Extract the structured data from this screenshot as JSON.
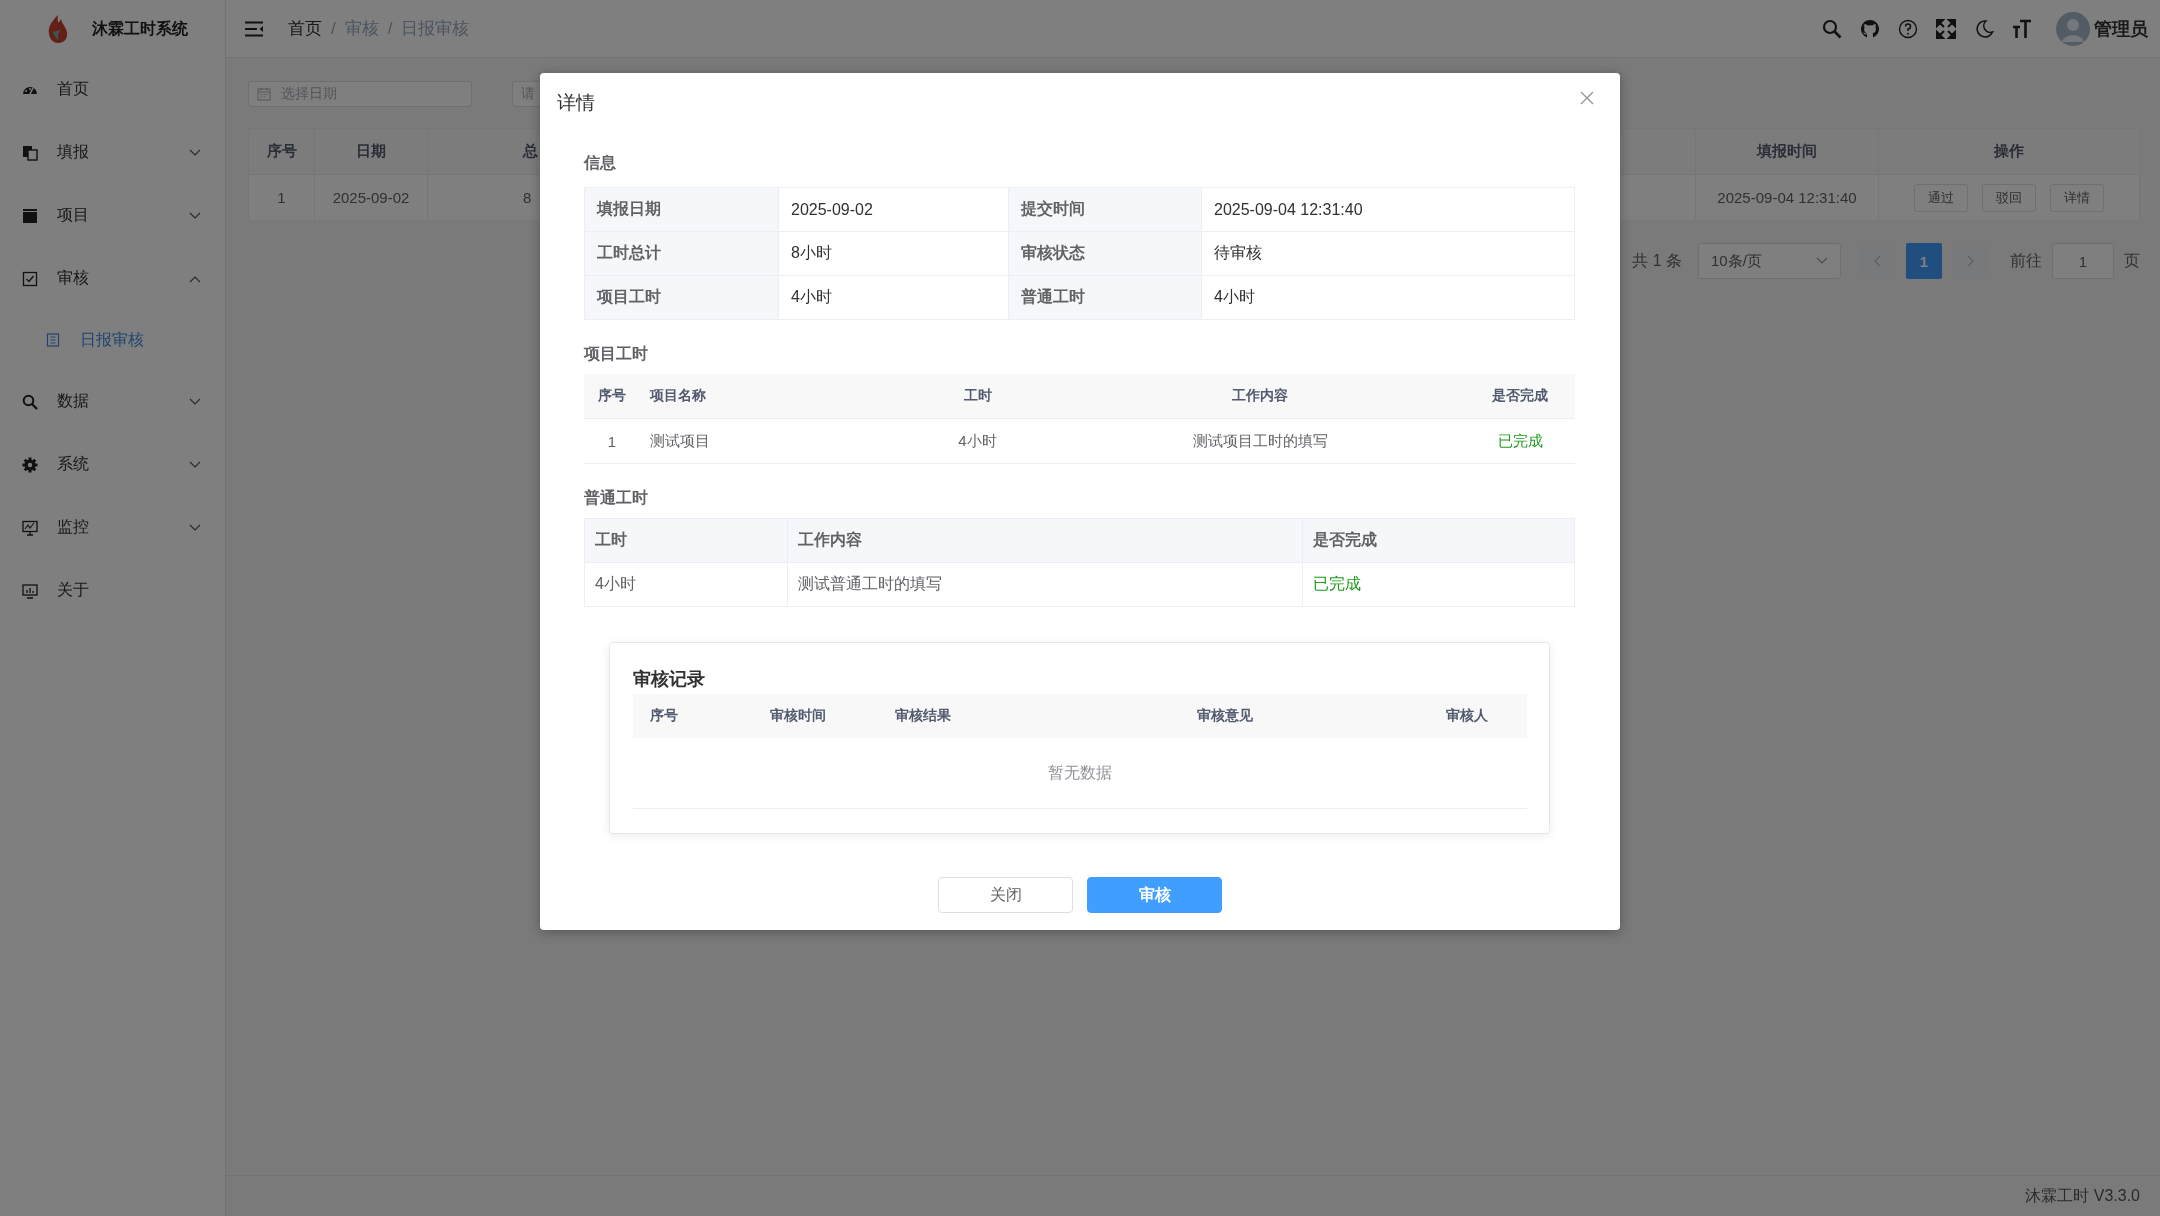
{
  "app": {
    "title": "沐霖工时系统"
  },
  "sidebar": {
    "items": [
      {
        "label": "首页",
        "kind": "link"
      },
      {
        "label": "填报",
        "kind": "group",
        "expanded": false
      },
      {
        "label": "项目",
        "kind": "group",
        "expanded": false
      },
      {
        "label": "审核",
        "kind": "group",
        "expanded": true,
        "children": [
          {
            "label": "日报审核",
            "selected": true
          }
        ]
      },
      {
        "label": "数据",
        "kind": "group",
        "expanded": false
      },
      {
        "label": "系统",
        "kind": "group",
        "expanded": false
      },
      {
        "label": "监控",
        "kind": "group",
        "expanded": false
      },
      {
        "label": "关于",
        "kind": "link"
      }
    ]
  },
  "header": {
    "breadcrumb": [
      {
        "label": "首页",
        "separator": "/"
      },
      {
        "label": "审核",
        "separator": "/"
      },
      {
        "label": "日报审核"
      }
    ],
    "user": {
      "name": "管理员"
    }
  },
  "filters": {
    "date": {
      "placeholder": "选择日期"
    },
    "field_2": {
      "placeholder": "请"
    }
  },
  "table": {
    "columns": [
      "序号",
      "日期",
      "总",
      "填报时间",
      "操作"
    ],
    "rows": [
      {
        "cells": [
          "1",
          "2025-09-02",
          "8",
          "2025-09-04 12:31:40"
        ],
        "actions": [
          "通过",
          "驳回",
          "详情"
        ]
      }
    ]
  },
  "pagination": {
    "total": "共 1 条",
    "page_size": "10条/页",
    "pages": [
      {
        "label": "1",
        "selected": true
      }
    ],
    "jump_label": "前往",
    "jump_value": "1",
    "jump_suffix": "页"
  },
  "footer": {
    "text": "沐霖工时 V3.3.0"
  },
  "dialog": {
    "title": "详情",
    "info": {
      "title": "信息",
      "rows": [
        [
          {
            "label": "填报日期",
            "value": "2025-09-02"
          },
          {
            "label": "提交时间",
            "value": "2025-09-04 12:31:40"
          }
        ],
        [
          {
            "label": "工时总计",
            "value": "8小时"
          },
          {
            "label": "审核状态",
            "value": "待审核"
          }
        ],
        [
          {
            "label": "项目工时",
            "value": "4小时"
          },
          {
            "label": "普通工时",
            "value": "4小时"
          }
        ]
      ]
    },
    "project_hours": {
      "title": "项目工时",
      "columns": [
        "序号",
        "项目名称",
        "工时",
        "工作内容",
        "是否完成"
      ],
      "rows": [
        {
          "index": "1",
          "name": "测试项目",
          "hours": "4小时",
          "content": "测试项目工时的填写",
          "status": "已完成",
          "completed": true
        }
      ]
    },
    "regular_hours": {
      "title": "普通工时",
      "columns": [
        "工时",
        "工作内容",
        "是否完成"
      ],
      "rows": [
        {
          "hours": "4小时",
          "content": "测试普通工时的填写",
          "status": "已完成",
          "completed": true
        }
      ]
    },
    "review_log": {
      "title": "审核记录",
      "columns": [
        "序号",
        "审核时间",
        "审核结果",
        "审核意见",
        "审核人"
      ],
      "empty_text": "暂无数据"
    },
    "buttons": [
      {
        "label": "关闭",
        "kind": "default"
      },
      {
        "label": "审核",
        "kind": "primary"
      }
    ]
  }
}
